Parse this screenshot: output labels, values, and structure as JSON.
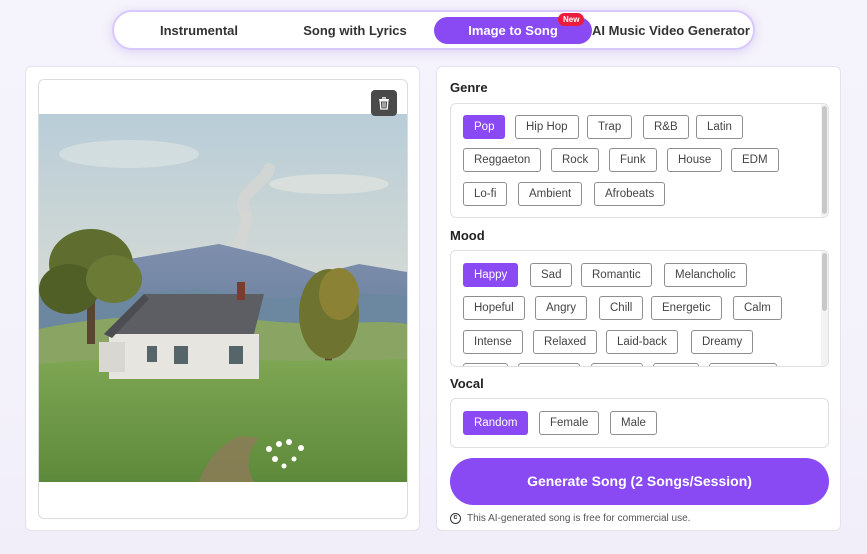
{
  "tabs": [
    {
      "label": "Instrumental"
    },
    {
      "label": "Song with Lyrics"
    },
    {
      "label": "Image to Song",
      "badge": "New",
      "active": true
    },
    {
      "label": "AI Music Video Generator"
    }
  ],
  "image_panel": {
    "delete_icon": "trash-icon"
  },
  "genre": {
    "title": "Genre",
    "selected": "Pop",
    "options": [
      "Pop",
      "Hip Hop",
      "Trap",
      "R&B",
      "Latin",
      "Reggaeton",
      "Rock",
      "Funk",
      "House",
      "EDM",
      "Lo-fi",
      "Ambient",
      "Afrobeats"
    ]
  },
  "mood": {
    "title": "Mood",
    "selected": "Happy",
    "options": [
      "Happy",
      "Sad",
      "Romantic",
      "Melancholic",
      "Hopeful",
      "Angry",
      "Chill",
      "Energetic",
      "Calm",
      "Intense",
      "Relaxed",
      "Laid-back",
      "Dreamy"
    ]
  },
  "vocal": {
    "title": "Vocal",
    "selected": "Random",
    "options": [
      "Random",
      "Female",
      "Male"
    ]
  },
  "generate_button": "Generate Song (2 Songs/Session)",
  "footnote": "This AI-generated song is free for commercial use.",
  "colors": {
    "accent": "#8a4af3",
    "badge": "#ec1c3c"
  }
}
